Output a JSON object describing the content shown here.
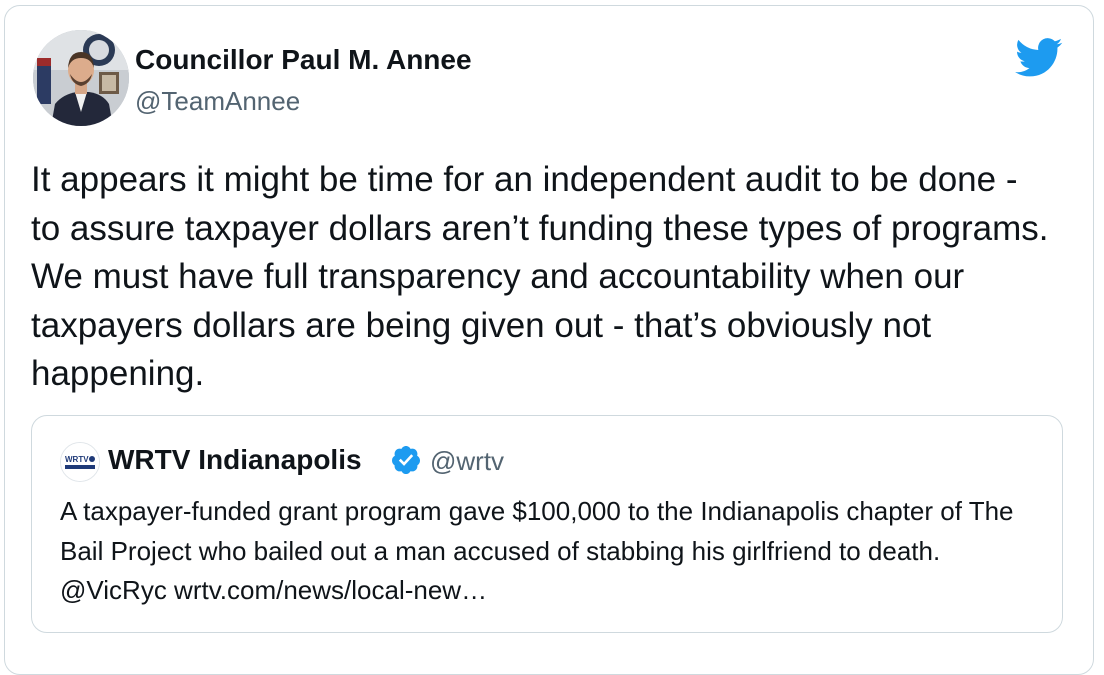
{
  "tweet": {
    "author_name": "Councillor Paul M. Annee",
    "author_handle": "@TeamAnnee",
    "text": "It appears it might be time for an independent audit to be done - to assure taxpayer dollars aren’t funding these types of programs. We must have full transparency and accountability when our taxpayers dollars are being given out - that’s obviously not happening.",
    "avatar_icon": "profile-photo",
    "brand_icon": "twitter-bird-icon",
    "brand_color": "#1d9bf0"
  },
  "quote": {
    "author_name": "WRTV Indianapolis",
    "author_handle": "@wrtv",
    "avatar_logo_text": "WRTV",
    "verified_icon": "verified-badge-icon",
    "text": "A taxpayer-funded grant program gave $100,000 to the Indianapolis chapter of The Bail Project who bailed out a man accused of stabbing his girlfriend to death. @VicRyc  wrtv.com/news/local-new…"
  }
}
